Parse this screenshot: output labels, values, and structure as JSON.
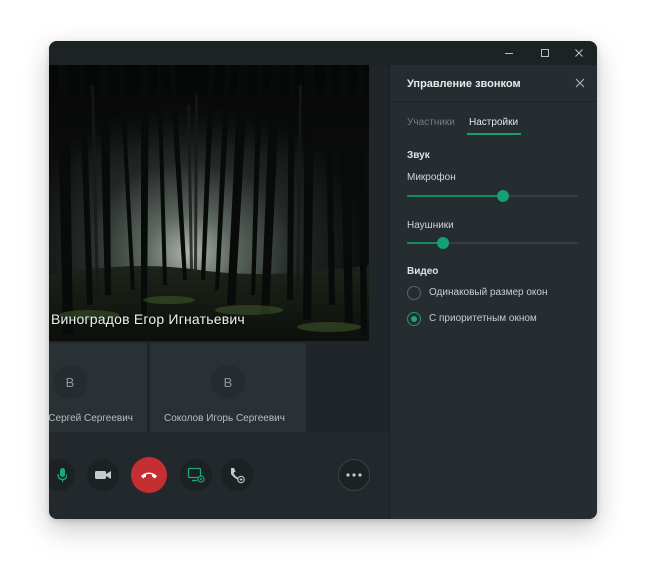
{
  "window": {
    "controls": {
      "minimize_icon": "minimize-icon",
      "maximize_icon": "maximize-icon",
      "close_icon": "close-icon"
    }
  },
  "call": {
    "main_speaker": "Виноградов Егор Игнатьевич",
    "participants": [
      {
        "initial": "В",
        "name": "Сергей Сергеевич"
      },
      {
        "initial": "В",
        "name": "Соколов Игорь Сергеевич"
      }
    ],
    "controls": [
      "microphone-icon",
      "camera-icon",
      "hang-up-icon",
      "screen-share-icon",
      "handset-transfer-icon",
      "more-icon"
    ]
  },
  "panel": {
    "title": "Управление звонком",
    "tabs": [
      {
        "label": "Участники",
        "active": false
      },
      {
        "label": "Настройки",
        "active": true
      }
    ],
    "sound": {
      "heading": "Звук",
      "microphone": {
        "label": "Микрофон",
        "level": 0.56
      },
      "headphones": {
        "label": "Наушники",
        "level": 0.21
      }
    },
    "video": {
      "heading": "Видео",
      "options": [
        {
          "label": "Одинаковый размер окон",
          "checked": false
        },
        {
          "label": "С приоритетным окном",
          "checked": true
        }
      ]
    }
  },
  "colors": {
    "accent": "#1a9c6f",
    "hang_up": "#c62f31",
    "panel_bg": "#262d31",
    "window_bg": "#22282c"
  }
}
